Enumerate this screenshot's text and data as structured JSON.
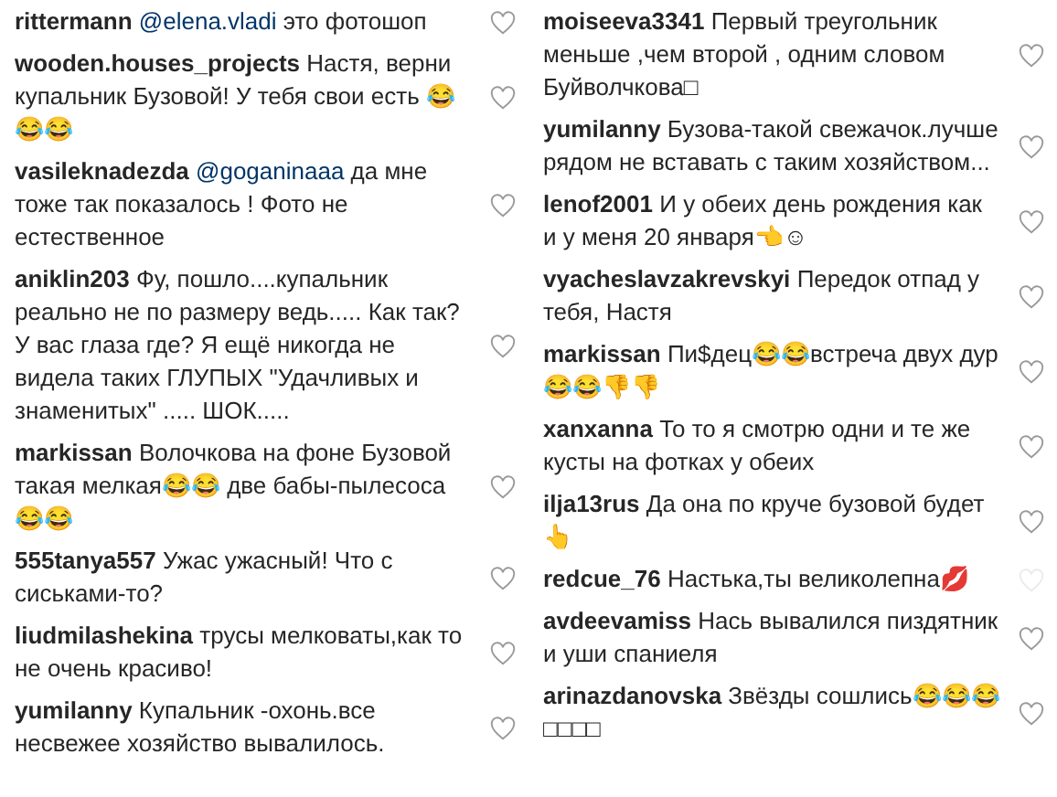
{
  "columns": [
    {
      "comments": [
        {
          "user": "rittermann",
          "mention": "@elena.vladi",
          "text": "это фотошоп",
          "faded": false
        },
        {
          "user": "wooden.houses_projects",
          "text": "Настя, верни купальник Бузовой! У тебя свои есть 😂😂😂",
          "faded": false
        },
        {
          "user": "vasileknadezda",
          "mention": "@goganinaaa",
          "text": "да мне тоже так показалось ! Фото не естественное",
          "faded": false
        },
        {
          "user": "aniklin203",
          "text": "Фу, пошло....купальник реально не по размеру ведь..... Как так? У вас глаза где? Я ещё никогда не видела таких ГЛУПЫХ \"Удачливых и знаменитых\" ..... ШОК.....",
          "faded": false
        },
        {
          "user": "markissan",
          "text": "Волочкова на фоне Бузовой такая мелкая😂😂 две бабы-пылесоса😂😂",
          "faded": false
        },
        {
          "user": "555tanya557",
          "text": "Ужас ужасный! Что с сиськами-то?",
          "faded": false
        },
        {
          "user": "liudmilashekina",
          "text": "трусы мелковаты,как то не очень красиво!",
          "faded": false
        },
        {
          "user": "yumilanny",
          "text": "Купальник -охонь.все несвежее хозяйство вывалилось.",
          "faded": false
        }
      ]
    },
    {
      "comments": [
        {
          "user": "moiseeva3341",
          "text": "Первый треугольник меньше ,чем второй , одним словом Буйволчкова□",
          "faded": false
        },
        {
          "user": "yumilanny",
          "text": "Бузова-такой свежачок.лучше рядом не вставать с таким хозяйством...",
          "faded": false
        },
        {
          "user": "lenof2001",
          "text": "И у обеих день рождения как и у меня 20 января👈☺",
          "faded": false
        },
        {
          "user": "vyacheslavzakrevskyi",
          "text": "Передок отпад у тебя, Настя",
          "faded": false
        },
        {
          "user": "markissan",
          "text": "Пи$дец😂😂встреча двух дур😂😂👎👎",
          "faded": false
        },
        {
          "user": "xanxanna",
          "text": "То то я смотрю одни и те же кусты на фотках у обеих",
          "faded": false
        },
        {
          "user": "ilja13rus",
          "text": "Да она по круче бузовой будет👆",
          "faded": false
        },
        {
          "user": "redcue_76",
          "text": "Настька,ты великолепна💋",
          "faded": true
        },
        {
          "user": "avdeevamiss",
          "text": "Нась вывалился пиздятник и уши спаниеля",
          "faded": false
        },
        {
          "user": "arinazdanovska",
          "text": "Звёзды сошлись😂😂😂□□□□",
          "faded": false
        }
      ]
    }
  ]
}
